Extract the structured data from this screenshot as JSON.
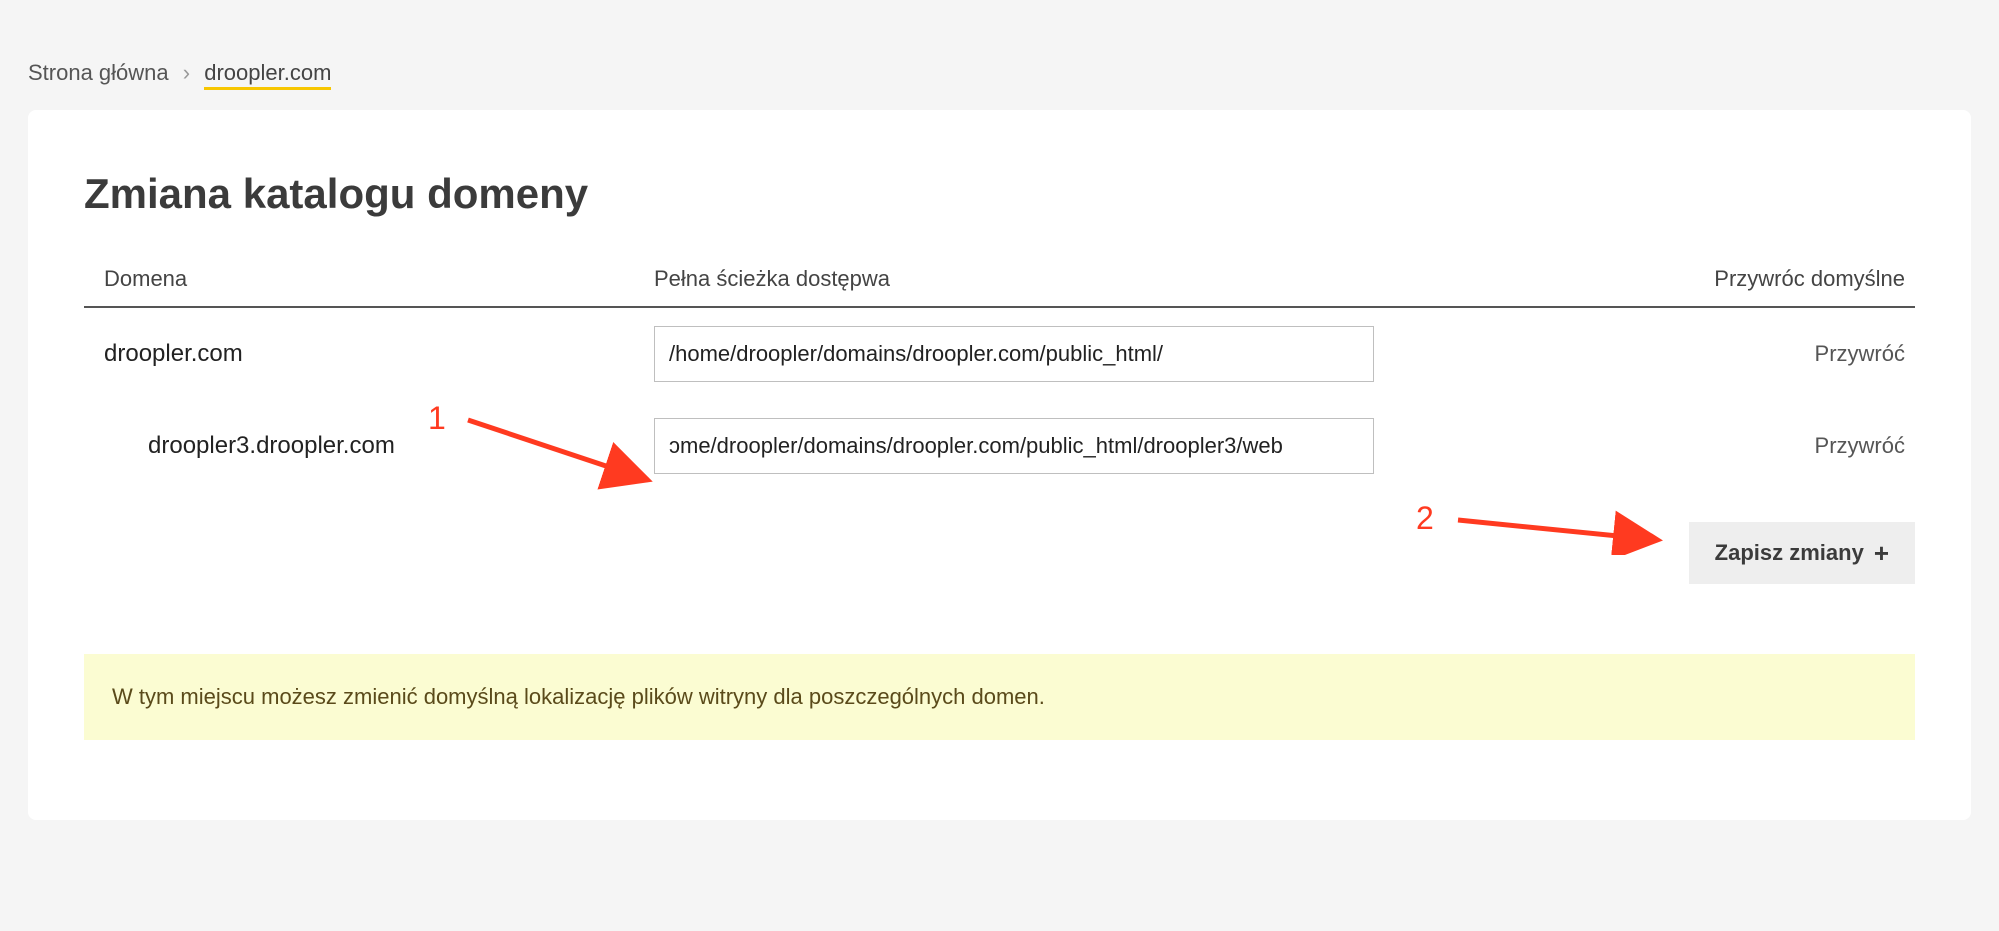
{
  "breadcrumb": {
    "home": "Strona główna",
    "separator": "›",
    "current": "droopler.com"
  },
  "title": "Zmiana katalogu domeny",
  "columns": {
    "domain": "Domena",
    "path": "Pełna ścieżka dostępwa",
    "restore": "Przywróc domyślne"
  },
  "rows": [
    {
      "domain": "droopler.com",
      "path": "/home/droopler/domains/droopler.com/public_html/",
      "restore": "Przywróć",
      "sub": false
    },
    {
      "domain": "droopler3.droopler.com",
      "path": "ɔme/droopler/domains/droopler.com/public_html/droopler3/web",
      "restore": "Przywróć",
      "sub": true
    }
  ],
  "save_button": "Zapisz zmiany",
  "info": "W tym miejscu możesz zmienić domyślną lokalizację plików witryny dla poszczególnych domen.",
  "annotations": {
    "one": "1",
    "two": "2"
  }
}
